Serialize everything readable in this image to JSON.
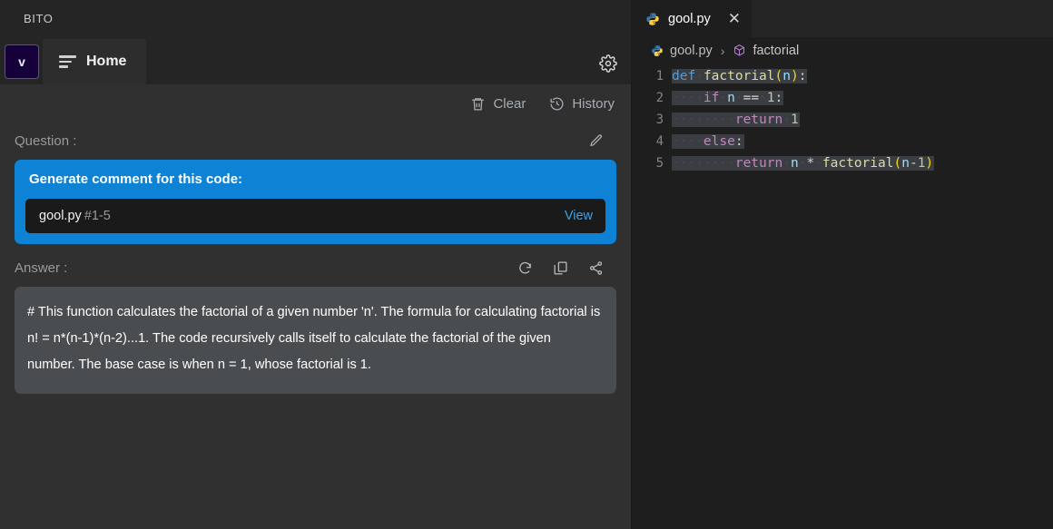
{
  "left_panel": {
    "app_title": "BITO",
    "avatar_initial": "v",
    "tab_label": "Home",
    "settings_icon": "gear-icon",
    "actions": [
      {
        "label": "Clear",
        "icon": "trash-icon"
      },
      {
        "label": "History",
        "icon": "history-icon"
      }
    ],
    "question": {
      "label": "Question :",
      "edit_icon": "pencil-icon",
      "prompt": "Generate comment for this code:",
      "file_name": "gool.py",
      "file_range": "#1-5",
      "view_label": "View"
    },
    "answer": {
      "label": "Answer :",
      "icons": [
        "refresh-icon",
        "copy-icon",
        "share-icon"
      ],
      "text": "# This function calculates the factorial of a given number 'n'. The formula for calculating factorial is n! = n*(n-1)*(n-2)...1. The code recursively calls itself to calculate the factorial of the given number. The base case is when n = 1, whose factorial is 1."
    }
  },
  "editor": {
    "tab": {
      "file_icon": "python-icon",
      "file_name": "gool.py",
      "close_icon": "close-icon"
    },
    "breadcrumb": {
      "file_icon": "python-icon",
      "file_name": "gool.py",
      "separator": "›",
      "symbol_icon": "cube-icon",
      "symbol_name": "factorial"
    },
    "code": {
      "line_numbers": [
        "1",
        "2",
        "3",
        "4",
        "5"
      ],
      "lines": [
        "def factorial(n):",
        "    if n == 1:",
        "        return 1",
        "    else:",
        "        return n * factorial(n-1)"
      ]
    }
  },
  "colors": {
    "accent_blue": "#0e82d4",
    "link_blue": "#3fa0e8",
    "panel_bg": "#303031",
    "editor_bg": "#1e1e1e",
    "titlebar_bg": "#252526",
    "answer_bg": "#4a4d50",
    "selection_bg": "#3a3d41"
  }
}
